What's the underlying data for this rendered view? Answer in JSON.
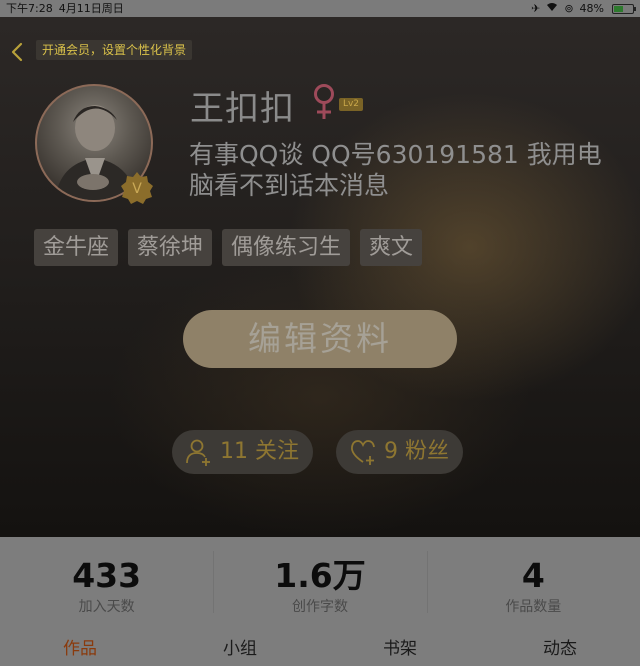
{
  "status_bar": {
    "time": "下午7:28",
    "date": "4月11日周日",
    "battery": "48%",
    "battery_level": 0.48
  },
  "header": {
    "vip_banner": "开通会员，设置个性化背景"
  },
  "profile": {
    "username": "王扣扣",
    "gender_symbol": "♀",
    "level": "Lv2",
    "vip_badge": "V",
    "bio": "有事QQ谈 QQ号630191581 我用电脑看不到话本消息",
    "tags": [
      "金牛座",
      "蔡徐坤",
      "偶像练习生",
      "爽文"
    ],
    "edit_button": "编辑资料",
    "following": "11 关注",
    "followers": "9 粉丝"
  },
  "stats": [
    {
      "value": "433",
      "label": "加入天数"
    },
    {
      "value": "1.6万",
      "label": "创作字数"
    },
    {
      "value": "4",
      "label": "作品数量"
    }
  ],
  "tabs": [
    {
      "label": "作品",
      "active": true
    },
    {
      "label": "小组",
      "active": false
    },
    {
      "label": "书架",
      "active": false
    },
    {
      "label": "动态",
      "active": false
    }
  ],
  "colors": {
    "accent_gold": "#8e7631",
    "active_tab": "#8a3a0c",
    "gender": "#9e4a5a"
  }
}
